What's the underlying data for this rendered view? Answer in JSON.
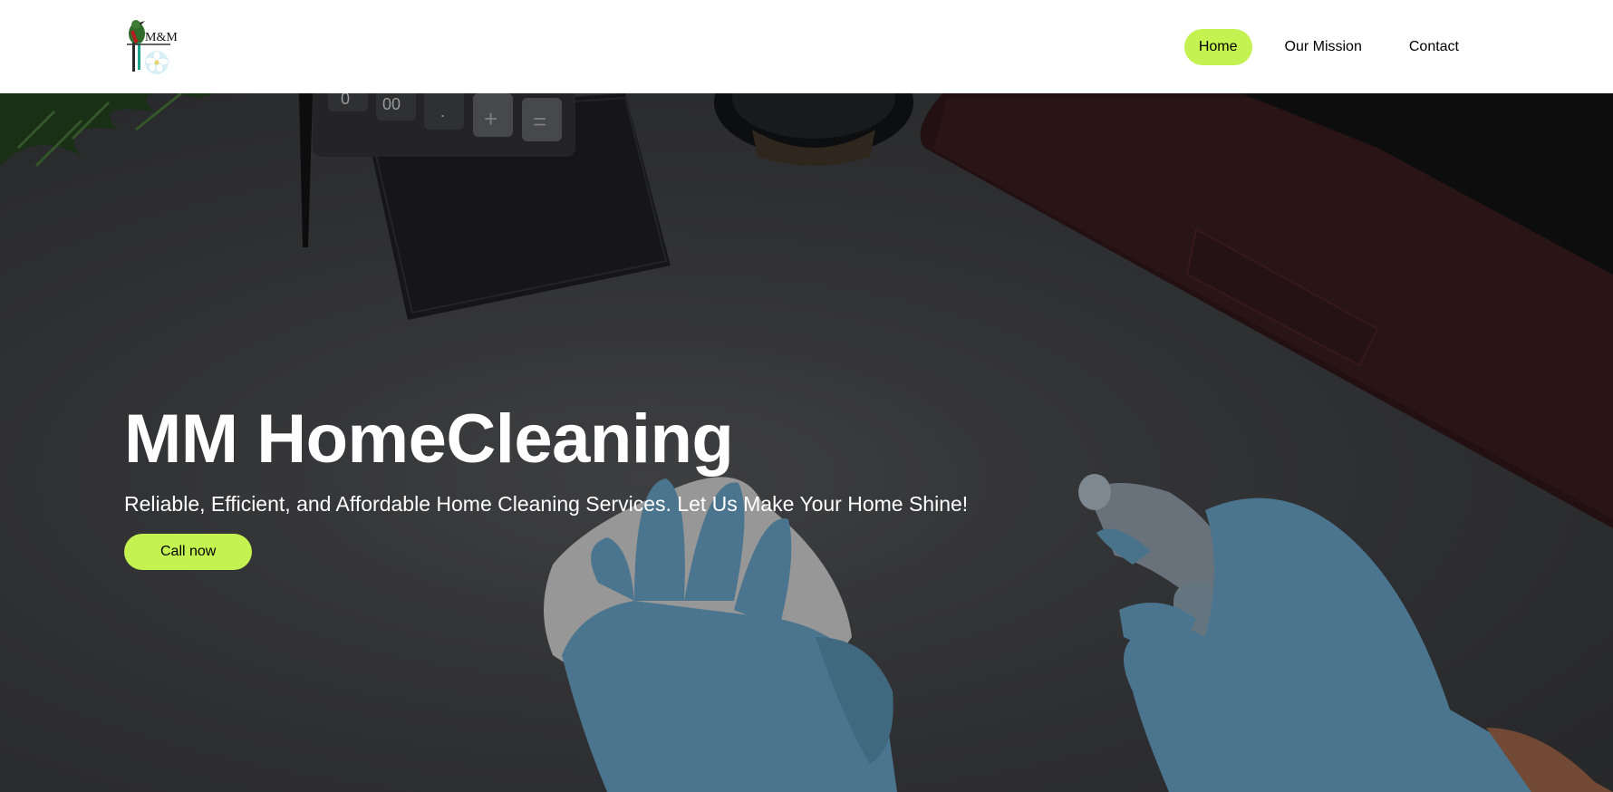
{
  "header": {
    "logo": {
      "text": "M&M",
      "icon": "bird-flower-logo"
    },
    "nav": [
      {
        "label": "Home",
        "active": true
      },
      {
        "label": "Our Mission",
        "active": false
      },
      {
        "label": "Contact",
        "active": false
      }
    ]
  },
  "hero": {
    "title": "MM HomeCleaning",
    "subtitle": "Reliable, Efficient, and Affordable Home Cleaning Services. Let Us Make Your Home Shine!",
    "cta_label": "Call now",
    "background_image": "desk-with-gloved-hands-cleaning-photo",
    "calculator_keys": [
      "0",
      "00",
      ".",
      "+",
      "="
    ]
  },
  "colors": {
    "accent": "#c4f250",
    "header_bg": "#ffffff",
    "text_light": "#ffffff",
    "glove": "#5c8fae"
  }
}
